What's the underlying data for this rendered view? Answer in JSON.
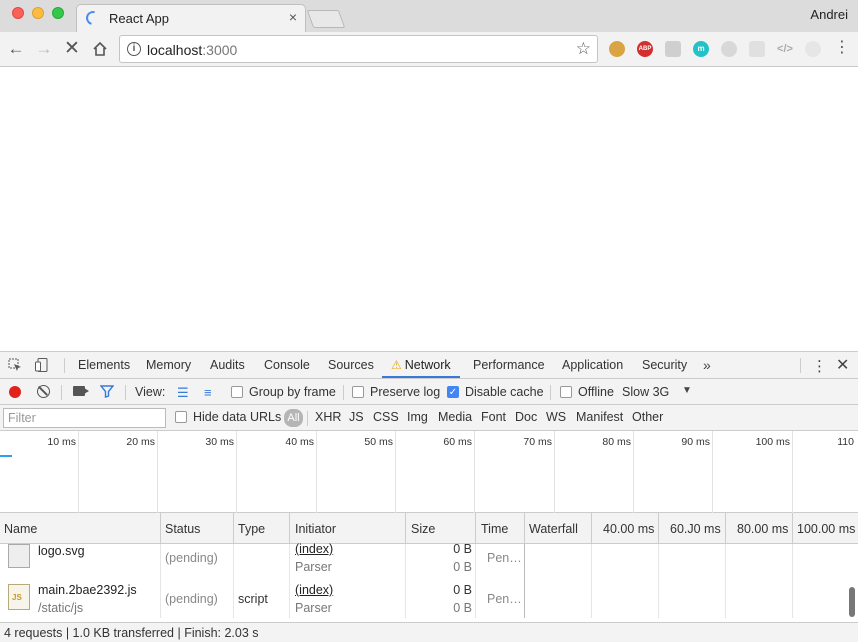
{
  "browser": {
    "tab_title": "React App",
    "tab_close": "×",
    "profile_name": "Andrei",
    "url_host": "localhost",
    "url_port": ":3000",
    "extensions": {
      "abp_label": "ABP",
      "m_label": "m",
      "code_label": "</>"
    },
    "icons": {
      "back": "arrow-left",
      "forward": "arrow-right",
      "stop": "close",
      "home": "home",
      "star": "star",
      "menu": "vertical-dots"
    }
  },
  "devtools": {
    "tabs": [
      "Elements",
      "Memory",
      "Audits",
      "Console",
      "Sources",
      "Network",
      "Performance",
      "Application",
      "Security"
    ],
    "active_tab": "Network",
    "more": "»",
    "toolbar": {
      "view_label": "View:",
      "group_by_frame": "Group by frame",
      "preserve_log": "Preserve log",
      "disable_cache": "Disable cache",
      "disable_cache_checked": true,
      "offline": "Offline",
      "throttle": "Slow 3G"
    },
    "filter": {
      "placeholder": "Filter",
      "hide_data_urls": "Hide data URLs",
      "types": [
        "All",
        "XHR",
        "JS",
        "CSS",
        "Img",
        "Media",
        "Font",
        "Doc",
        "WS",
        "Manifest",
        "Other"
      ],
      "active_type": "All"
    },
    "overview_ticks": [
      "10 ms",
      "20 ms",
      "30 ms",
      "40 ms",
      "50 ms",
      "60 ms",
      "70 ms",
      "80 ms",
      "90 ms",
      "100 ms",
      "110"
    ],
    "columns": {
      "name": "Name",
      "status": "Status",
      "type": "Type",
      "initiator": "Initiator",
      "size": "Size",
      "time": "Time",
      "waterfall": "Waterfall",
      "waterfall_ticks": [
        "40.00 ms",
        "60.J0 ms",
        "80.00 ms",
        "100.00 ms"
      ]
    },
    "requests": [
      {
        "name": "logo.svg",
        "status": "(pending)",
        "type": "",
        "initiator": "(index)",
        "initiator_sub": "Parser",
        "size": "0 B",
        "size_sub": "0 B",
        "time": "Pen…"
      },
      {
        "name": "main.2bae2392.js",
        "path": "/static/js",
        "status": "(pending)",
        "type": "script",
        "initiator": "(index)",
        "initiator_sub": "Parser",
        "size": "0 B",
        "size_sub": "0 B",
        "time": "Pen…"
      }
    ],
    "status_bar": "4 requests | 1.0 KB transferred | Finish: 2.03 s"
  }
}
